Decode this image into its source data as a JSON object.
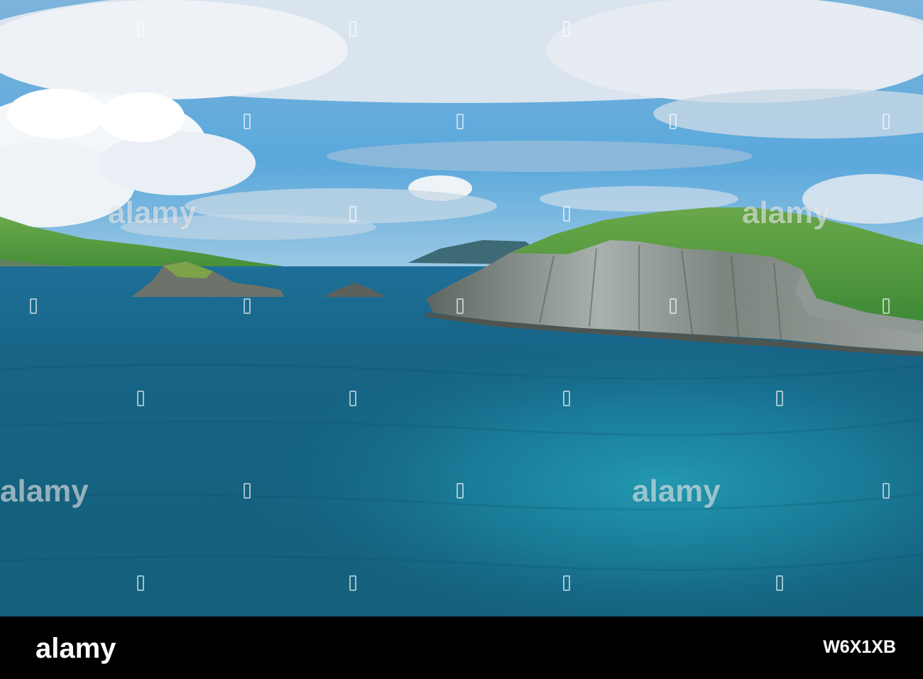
{
  "image": {
    "watermark_text": "alamy",
    "footer": {
      "brand": "alamy",
      "image_id": "W6X1XB"
    },
    "colors": {
      "sky": "#5fa8d6",
      "cloud": "#f2f5f8",
      "sea_deep": "#135f7e",
      "sea_turquoise": "#1f8faa",
      "grass": "#4f9a3c",
      "cliff": "#8e9696",
      "footer_bg": "#000000"
    }
  }
}
